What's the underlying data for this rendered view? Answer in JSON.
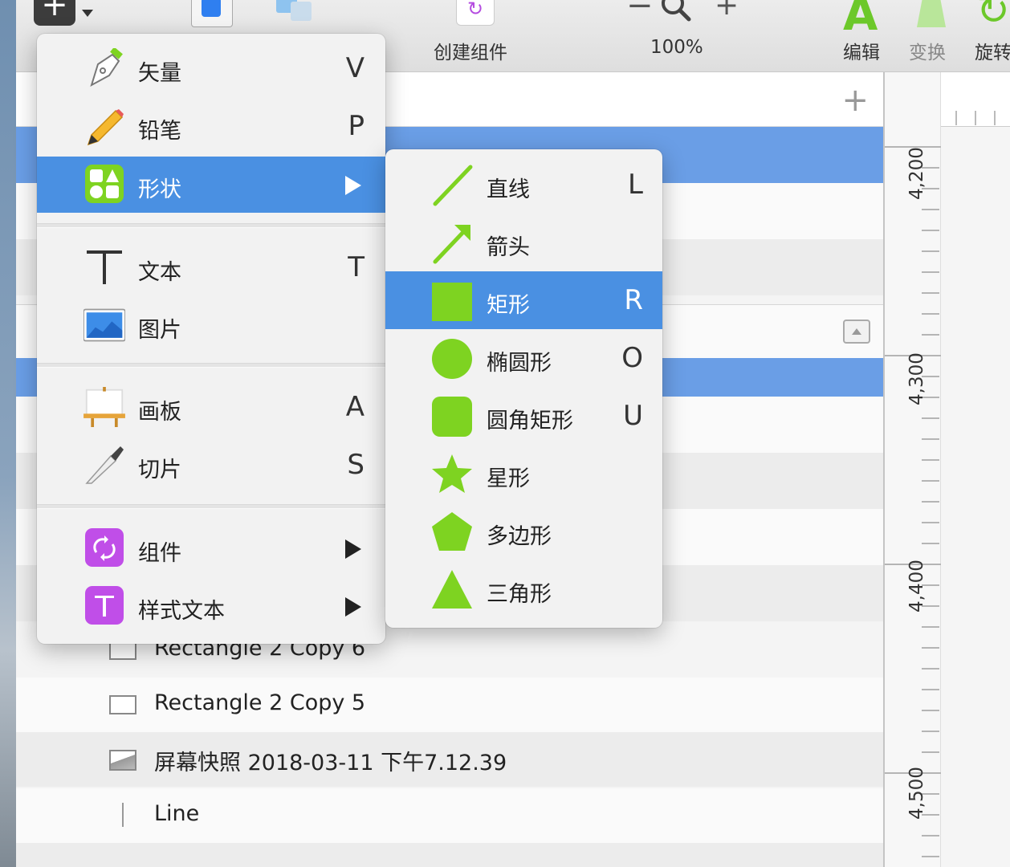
{
  "toolbar": {
    "insert_icon": "plus-icon",
    "create_symbol_label": "创建组件",
    "zoom_level": "100%",
    "zoom_minus": "−",
    "zoom_plus": "+",
    "edit_label": "编辑",
    "transform_label": "变换",
    "rotate_label": "旋转"
  },
  "layers": {
    "add_symbol": "+",
    "items": [
      {
        "icon": "rectangle-icon",
        "name": "Rectangle 2 Copy 6"
      },
      {
        "icon": "rectangle-icon",
        "name": "Rectangle 2 Copy 5"
      },
      {
        "icon": "image-icon",
        "name": "屏幕快照 2018-03-11 下午7.12.39"
      },
      {
        "icon": "line-icon",
        "name": "Line"
      }
    ]
  },
  "ruler": {
    "labels": [
      "4,200",
      "4,300",
      "4,400",
      "4,500"
    ]
  },
  "menu": {
    "items": [
      {
        "label": "矢量",
        "key": "V",
        "icon": "pen-icon"
      },
      {
        "label": "铅笔",
        "key": "P",
        "icon": "pencil-icon"
      },
      {
        "label": "形状",
        "key": "",
        "icon": "shapes-icon",
        "submenu": true,
        "active": true
      },
      {
        "label": "文本",
        "key": "T",
        "icon": "text-icon"
      },
      {
        "label": "图片",
        "key": "",
        "icon": "image-icon"
      },
      {
        "label": "画板",
        "key": "A",
        "icon": "artboard-icon"
      },
      {
        "label": "切片",
        "key": "S",
        "icon": "slice-knife-icon"
      },
      {
        "label": "组件",
        "key": "",
        "icon": "symbol-icon",
        "submenu": true
      },
      {
        "label": "样式文本",
        "key": "",
        "icon": "text-style-icon",
        "submenu": true
      }
    ]
  },
  "submenu": {
    "items": [
      {
        "label": "直线",
        "key": "L",
        "icon": "line-icon"
      },
      {
        "label": "箭头",
        "key": "",
        "icon": "arrow-icon"
      },
      {
        "label": "矩形",
        "key": "R",
        "icon": "rectangle-icon",
        "active": true
      },
      {
        "label": "椭圆形",
        "key": "O",
        "icon": "oval-icon"
      },
      {
        "label": "圆角矩形",
        "key": "U",
        "icon": "rounded-rectangle-icon"
      },
      {
        "label": "星形",
        "key": "",
        "icon": "star-icon"
      },
      {
        "label": "多边形",
        "key": "",
        "icon": "polygon-icon"
      },
      {
        "label": "三角形",
        "key": "",
        "icon": "triangle-icon"
      }
    ]
  },
  "colors": {
    "accent": "#4a90e2",
    "selection": "#6a9ee6",
    "shape_green": "#7ed321",
    "symbol_purple": "#b44ce0"
  }
}
